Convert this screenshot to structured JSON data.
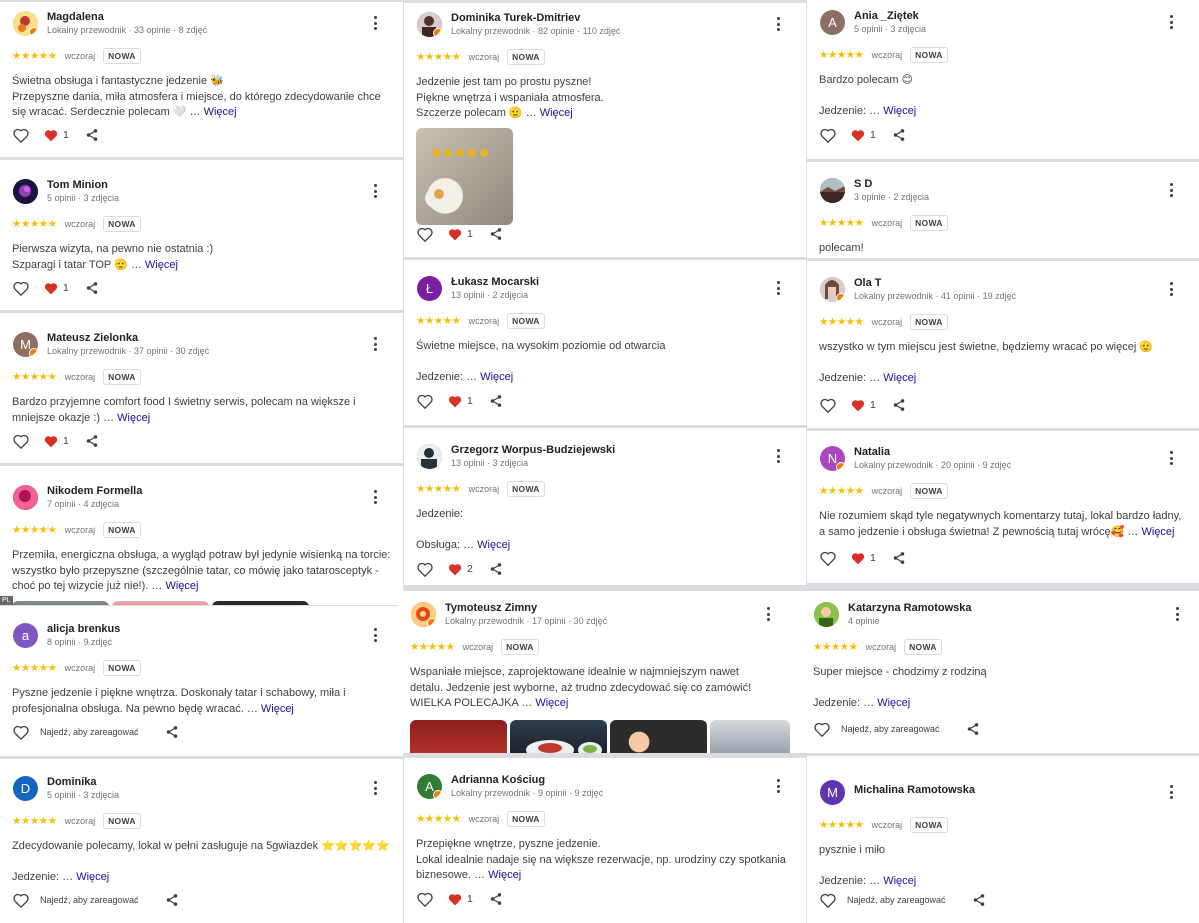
{
  "labels": {
    "new_badge": "NOWA",
    "more_link": "Więcej",
    "react_hint": "Najedź, aby zareagować",
    "stars": "★★★★★"
  },
  "reviews": [
    {
      "name": "Magdalena",
      "meta": "Lokalny przewodnik · 33 opinie · 8 zdjęć",
      "when": "wczoraj",
      "text": [
        "Świetna obsługa i fantastyczne jedzenie 🐝",
        "Przepyszne dania, miła atmosfera i miejsce, do którego zdecydowanie chce się wracać. Serdecznie polecam 🤍 … "
      ],
      "likes": "1",
      "avatar_color": "#f1c40f"
    },
    {
      "name": "Tom Minion",
      "meta": "5 opinii · 3 zdjęcia",
      "when": "wczoraj",
      "text": [
        "Pierwsza wizyta, na pewno nie ostatnia :)",
        "Szparagi i tatar TOP 🫡 … "
      ],
      "likes": "1",
      "avatar_color": "#2a1a6e"
    },
    {
      "name": "Mateusz Zielonka",
      "initial": "M",
      "meta": "Lokalny przewodnik · 37 opinii · 30 zdjęć",
      "when": "wczoraj",
      "text": [
        "Bardzo przyjemne comfort food I świetny serwis, polecam na większe i mniejsze okazje :) … "
      ],
      "likes": "1",
      "avatar_color": "#8d6e63"
    },
    {
      "name": "Nikodem Formella",
      "meta": "7 opinii · 4 zdjęcia",
      "when": "wczoraj",
      "text": [
        "Przemiła, energiczna obsługa, a wygląd potraw był jedynie wisienką na torcie: wszystko było przepyszne (szczególnie tatar, co mówię jako tatarosceptyk - choć po tej wizycie już nie!). … "
      ],
      "avatar_color": "#e91e63",
      "tag": "PL"
    },
    {
      "name": "alicja brenkus",
      "initial": "a",
      "meta": "8 opinii · 9 zdjęć",
      "when": "wczoraj",
      "text": [
        "Pyszne jedzenie i piękne wnętrza. Doskonały tatar i schabowy, miła i profesjonalna obsługa. Na pewno będę wracać. … "
      ],
      "avatar_color": "#7e57c2"
    },
    {
      "name": "Dominika",
      "initial": "D",
      "meta": "5 opinii · 3 zdjęcia",
      "when": "wczoraj",
      "text": [
        "Zdecydowanie polecamy, lokal w pełni zasługuje na 5gwiazdek ⭐⭐⭐⭐⭐",
        "",
        "Jedzenie: … "
      ],
      "avatar_color": "#1565c0"
    },
    {
      "name": "Dominika Turek-Dmitriev",
      "meta": "Lokalny przewodnik · 82 opinie · 110 zdjęć",
      "when": "wczoraj",
      "text": [
        "Jedzenie jest tam po prostu pyszne!",
        "Piękne wnętrza i wspaniała atmosfera.",
        "Szczerze polecam 🫡 … "
      ],
      "likes": "1",
      "avatar_color": "#6d4c41"
    },
    {
      "name": "Łukasz Mocarski",
      "initial": "Ł",
      "meta": "13 opinii · 2 zdjęcia",
      "when": "wczoraj",
      "text": [
        "Świetne miejsce, na wysokim poziomie od otwarcia",
        "",
        "Jedzenie: … "
      ],
      "likes": "1",
      "avatar_color": "#7b1fa2"
    },
    {
      "name": "Grzegorz Worpus-Budziejewski",
      "meta": "13 opinii · 3 zdjęcia",
      "when": "wczoraj",
      "text": [
        "Jedzenie:",
        "",
        "Obsługa: … "
      ],
      "likes": "2",
      "avatar_color": "#37474f"
    },
    {
      "name": "Tymoteusz Zimny",
      "meta": "Lokalny przewodnik · 17 opinii · 30 zdjęć",
      "when": "wczoraj",
      "text": [
        "Wspaniałe miejsce, zaprojektowane idealnie w najmniejszym nawet detalu. Jedzenie jest wyborne, aż trudno zdecydować się co zamówić! WIELKA POLECAJKA … "
      ],
      "avatar_color": "#d84315"
    },
    {
      "name": "Adrianna Kościug",
      "initial": "A",
      "meta": "Lokalny przewodnik · 9 opinii · 9 zdjęć",
      "when": "wczoraj",
      "text": [
        "Przepiękne wnętrze, pyszne jedzenie.",
        "Lokal idealnie nadaje się na większe rezerwacje, np. urodziny czy spotkania biznesowe. … "
      ],
      "likes": "1",
      "avatar_color": "#2e7d32"
    },
    {
      "name": "Ania _Ziętek",
      "initial": "A",
      "meta": "5 opinii · 3 zdjęcia",
      "when": "wczoraj",
      "text": [
        "Bardzo polecam 😊",
        "",
        "Jedzenie: … "
      ],
      "likes": "1",
      "avatar_color": "#8d6e63"
    },
    {
      "name": "S D",
      "meta": "3 opinie · 2 zdjęcia",
      "when": "wczoraj",
      "text": [
        "polecam!"
      ],
      "avatar_color": "#5d4037"
    },
    {
      "name": "Ola T",
      "meta": "Lokalny przewodnik · 41 opinii · 19 zdjęć",
      "when": "wczoraj",
      "text": [
        "wszystko w tym miejscu jest świetne, będziemy wracać po więcej 🫡",
        "",
        "Jedzenie: … "
      ],
      "likes": "1",
      "avatar_color": "#a1887f"
    },
    {
      "name": "Natalia",
      "initial": "N",
      "meta": "Lokalny przewodnik · 20 opinii · 9 zdjęć",
      "when": "wczoraj",
      "text": [
        "Nie rozumiem skąd tyle negatywnych komentarzy tutaj, lokal bardzo ładny, a samo jedzenie i obsługa świetna! Z pewnością tutaj wrócę🥰 … "
      ],
      "likes": "1",
      "avatar_color": "#ab47bc"
    },
    {
      "name": "Katarzyna Ramotowska",
      "meta": "4 opinie",
      "when": "wczoraj",
      "text": [
        "Super miejsce - chodzimy z rodziną",
        "",
        "Jedzenie: … "
      ],
      "avatar_color": "#558b2f"
    },
    {
      "name": "Michalina Ramotowska",
      "initial": "M",
      "meta": "",
      "when": "wczoraj",
      "text": [
        "pysznie i miło",
        "",
        "Jedzenie: … "
      ],
      "avatar_color": "#5e35b1"
    }
  ]
}
